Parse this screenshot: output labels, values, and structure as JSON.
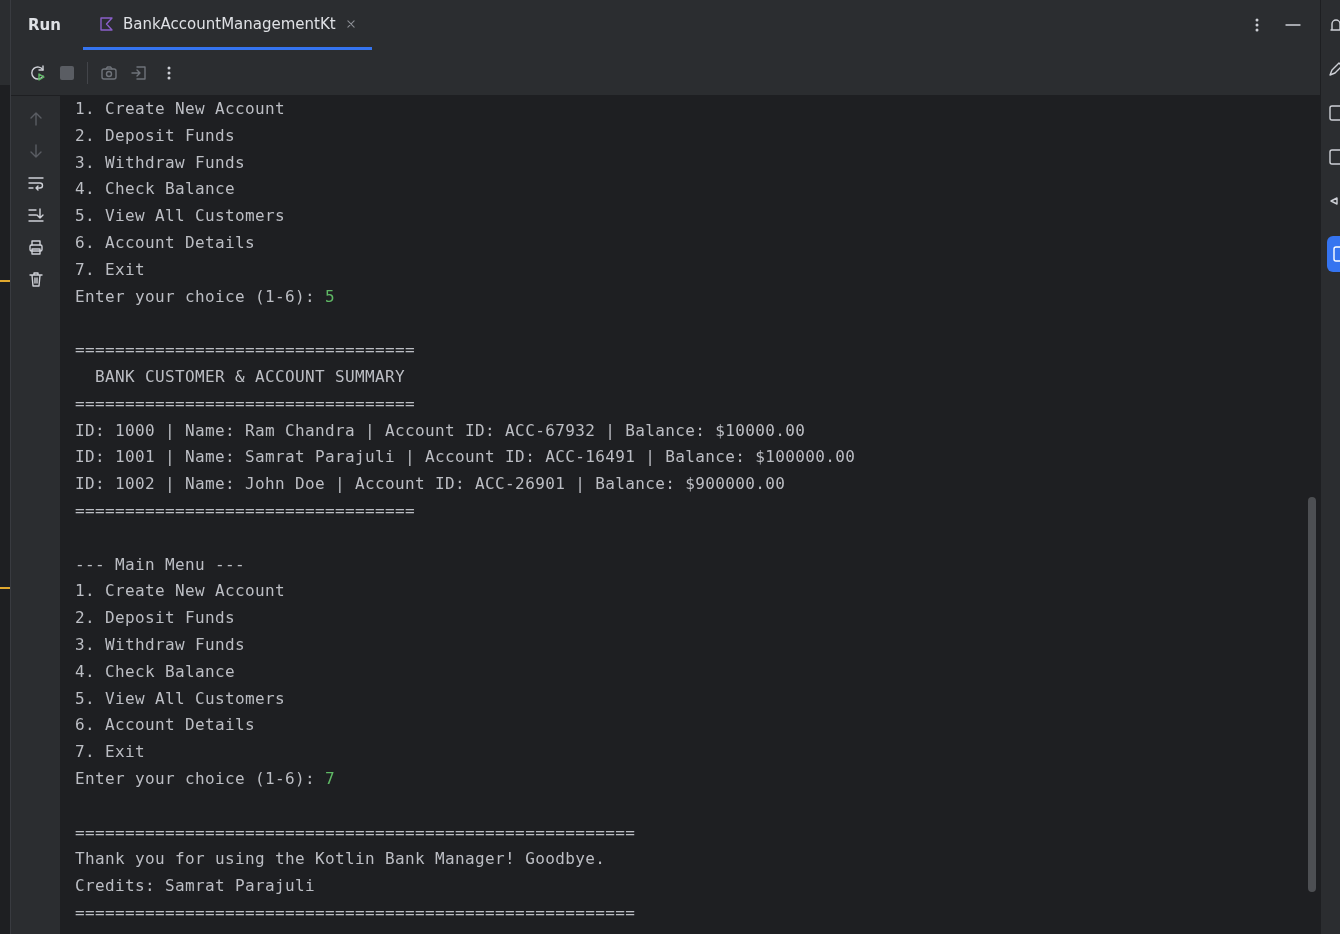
{
  "header": {
    "title": "Run",
    "tabs": [
      {
        "label": "BankAccountManagementKt",
        "selected": true
      }
    ]
  },
  "console": {
    "lines": [
      {
        "kind": "text",
        "text": "1. Create New Account"
      },
      {
        "kind": "text",
        "text": "2. Deposit Funds"
      },
      {
        "kind": "text",
        "text": "3. Withdraw Funds"
      },
      {
        "kind": "text",
        "text": "4. Check Balance"
      },
      {
        "kind": "text",
        "text": "5. View All Customers"
      },
      {
        "kind": "text",
        "text": "6. Account Details"
      },
      {
        "kind": "text",
        "text": "7. Exit"
      },
      {
        "kind": "input",
        "text": "Enter your choice (1-6): ",
        "input": "5"
      },
      {
        "kind": "blank"
      },
      {
        "kind": "text",
        "text": "=================================="
      },
      {
        "kind": "text",
        "text": "  BANK CUSTOMER & ACCOUNT SUMMARY"
      },
      {
        "kind": "text",
        "text": "=================================="
      },
      {
        "kind": "text",
        "text": "ID: 1000 | Name: Ram Chandra | Account ID: ACC-67932 | Balance: $10000.00"
      },
      {
        "kind": "text",
        "text": "ID: 1001 | Name: Samrat Parajuli | Account ID: ACC-16491 | Balance: $100000.00"
      },
      {
        "kind": "text",
        "text": "ID: 1002 | Name: John Doe | Account ID: ACC-26901 | Balance: $900000.00"
      },
      {
        "kind": "text",
        "text": "=================================="
      },
      {
        "kind": "blank"
      },
      {
        "kind": "text",
        "text": "--- Main Menu ---"
      },
      {
        "kind": "text",
        "text": "1. Create New Account"
      },
      {
        "kind": "text",
        "text": "2. Deposit Funds"
      },
      {
        "kind": "text",
        "text": "3. Withdraw Funds"
      },
      {
        "kind": "text",
        "text": "4. Check Balance"
      },
      {
        "kind": "text",
        "text": "5. View All Customers"
      },
      {
        "kind": "text",
        "text": "6. Account Details"
      },
      {
        "kind": "text",
        "text": "7. Exit"
      },
      {
        "kind": "input",
        "text": "Enter your choice (1-6): ",
        "input": "7"
      },
      {
        "kind": "blank"
      },
      {
        "kind": "text",
        "text": "========================================================"
      },
      {
        "kind": "text",
        "text": "Thank you for using the Kotlin Bank Manager! Goodbye."
      },
      {
        "kind": "text",
        "text": "Credits: Samrat Parajuli"
      },
      {
        "kind": "text",
        "text": "========================================================"
      }
    ]
  }
}
